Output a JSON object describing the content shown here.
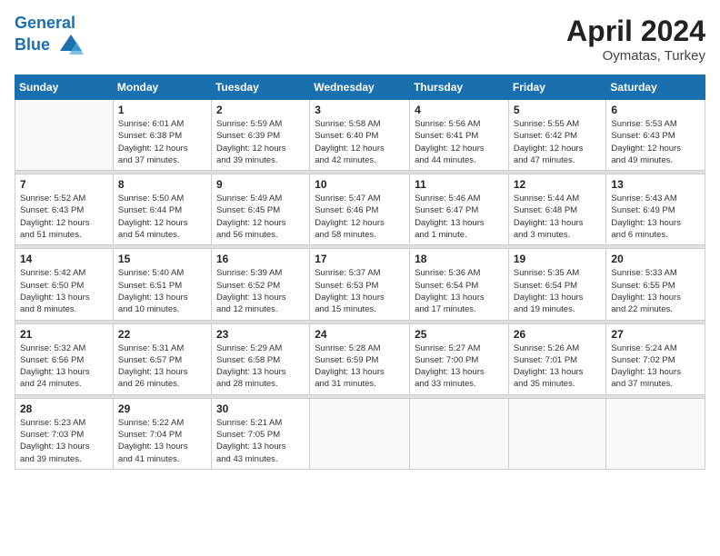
{
  "header": {
    "logo_line1": "General",
    "logo_line2": "Blue",
    "month": "April 2024",
    "location": "Oymatas, Turkey"
  },
  "weekdays": [
    "Sunday",
    "Monday",
    "Tuesday",
    "Wednesday",
    "Thursday",
    "Friday",
    "Saturday"
  ],
  "weeks": [
    [
      {
        "day": "",
        "info": ""
      },
      {
        "day": "1",
        "info": "Sunrise: 6:01 AM\nSunset: 6:38 PM\nDaylight: 12 hours\nand 37 minutes."
      },
      {
        "day": "2",
        "info": "Sunrise: 5:59 AM\nSunset: 6:39 PM\nDaylight: 12 hours\nand 39 minutes."
      },
      {
        "day": "3",
        "info": "Sunrise: 5:58 AM\nSunset: 6:40 PM\nDaylight: 12 hours\nand 42 minutes."
      },
      {
        "day": "4",
        "info": "Sunrise: 5:56 AM\nSunset: 6:41 PM\nDaylight: 12 hours\nand 44 minutes."
      },
      {
        "day": "5",
        "info": "Sunrise: 5:55 AM\nSunset: 6:42 PM\nDaylight: 12 hours\nand 47 minutes."
      },
      {
        "day": "6",
        "info": "Sunrise: 5:53 AM\nSunset: 6:43 PM\nDaylight: 12 hours\nand 49 minutes."
      }
    ],
    [
      {
        "day": "7",
        "info": "Sunrise: 5:52 AM\nSunset: 6:43 PM\nDaylight: 12 hours\nand 51 minutes."
      },
      {
        "day": "8",
        "info": "Sunrise: 5:50 AM\nSunset: 6:44 PM\nDaylight: 12 hours\nand 54 minutes."
      },
      {
        "day": "9",
        "info": "Sunrise: 5:49 AM\nSunset: 6:45 PM\nDaylight: 12 hours\nand 56 minutes."
      },
      {
        "day": "10",
        "info": "Sunrise: 5:47 AM\nSunset: 6:46 PM\nDaylight: 12 hours\nand 58 minutes."
      },
      {
        "day": "11",
        "info": "Sunrise: 5:46 AM\nSunset: 6:47 PM\nDaylight: 13 hours\nand 1 minute."
      },
      {
        "day": "12",
        "info": "Sunrise: 5:44 AM\nSunset: 6:48 PM\nDaylight: 13 hours\nand 3 minutes."
      },
      {
        "day": "13",
        "info": "Sunrise: 5:43 AM\nSunset: 6:49 PM\nDaylight: 13 hours\nand 6 minutes."
      }
    ],
    [
      {
        "day": "14",
        "info": "Sunrise: 5:42 AM\nSunset: 6:50 PM\nDaylight: 13 hours\nand 8 minutes."
      },
      {
        "day": "15",
        "info": "Sunrise: 5:40 AM\nSunset: 6:51 PM\nDaylight: 13 hours\nand 10 minutes."
      },
      {
        "day": "16",
        "info": "Sunrise: 5:39 AM\nSunset: 6:52 PM\nDaylight: 13 hours\nand 12 minutes."
      },
      {
        "day": "17",
        "info": "Sunrise: 5:37 AM\nSunset: 6:53 PM\nDaylight: 13 hours\nand 15 minutes."
      },
      {
        "day": "18",
        "info": "Sunrise: 5:36 AM\nSunset: 6:54 PM\nDaylight: 13 hours\nand 17 minutes."
      },
      {
        "day": "19",
        "info": "Sunrise: 5:35 AM\nSunset: 6:54 PM\nDaylight: 13 hours\nand 19 minutes."
      },
      {
        "day": "20",
        "info": "Sunrise: 5:33 AM\nSunset: 6:55 PM\nDaylight: 13 hours\nand 22 minutes."
      }
    ],
    [
      {
        "day": "21",
        "info": "Sunrise: 5:32 AM\nSunset: 6:56 PM\nDaylight: 13 hours\nand 24 minutes."
      },
      {
        "day": "22",
        "info": "Sunrise: 5:31 AM\nSunset: 6:57 PM\nDaylight: 13 hours\nand 26 minutes."
      },
      {
        "day": "23",
        "info": "Sunrise: 5:29 AM\nSunset: 6:58 PM\nDaylight: 13 hours\nand 28 minutes."
      },
      {
        "day": "24",
        "info": "Sunrise: 5:28 AM\nSunset: 6:59 PM\nDaylight: 13 hours\nand 31 minutes."
      },
      {
        "day": "25",
        "info": "Sunrise: 5:27 AM\nSunset: 7:00 PM\nDaylight: 13 hours\nand 33 minutes."
      },
      {
        "day": "26",
        "info": "Sunrise: 5:26 AM\nSunset: 7:01 PM\nDaylight: 13 hours\nand 35 minutes."
      },
      {
        "day": "27",
        "info": "Sunrise: 5:24 AM\nSunset: 7:02 PM\nDaylight: 13 hours\nand 37 minutes."
      }
    ],
    [
      {
        "day": "28",
        "info": "Sunrise: 5:23 AM\nSunset: 7:03 PM\nDaylight: 13 hours\nand 39 minutes."
      },
      {
        "day": "29",
        "info": "Sunrise: 5:22 AM\nSunset: 7:04 PM\nDaylight: 13 hours\nand 41 minutes."
      },
      {
        "day": "30",
        "info": "Sunrise: 5:21 AM\nSunset: 7:05 PM\nDaylight: 13 hours\nand 43 minutes."
      },
      {
        "day": "",
        "info": ""
      },
      {
        "day": "",
        "info": ""
      },
      {
        "day": "",
        "info": ""
      },
      {
        "day": "",
        "info": ""
      }
    ]
  ]
}
